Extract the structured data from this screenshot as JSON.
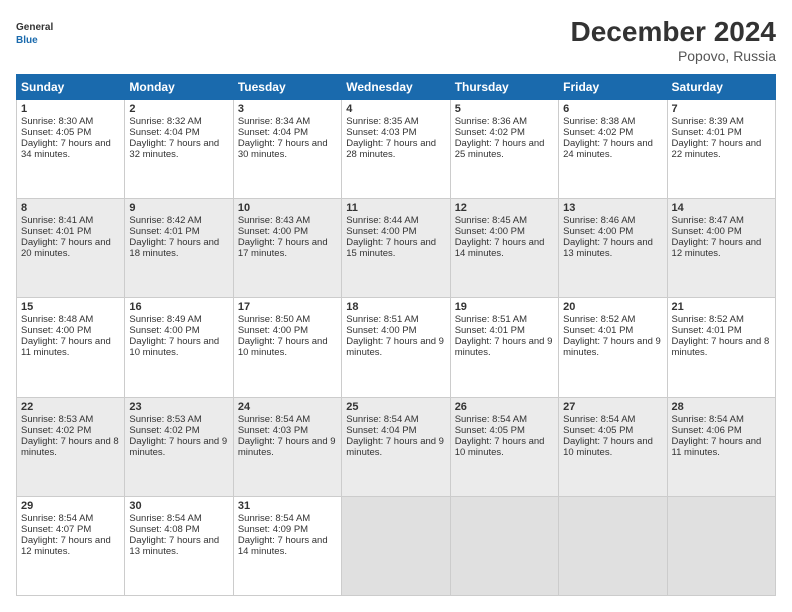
{
  "header": {
    "logo_line1": "General",
    "logo_line2": "Blue",
    "month": "December 2024",
    "location": "Popovo, Russia"
  },
  "weekdays": [
    "Sunday",
    "Monday",
    "Tuesday",
    "Wednesday",
    "Thursday",
    "Friday",
    "Saturday"
  ],
  "weeks": [
    [
      {
        "day": "1",
        "sunrise": "Sunrise: 8:30 AM",
        "sunset": "Sunset: 4:05 PM",
        "daylight": "Daylight: 7 hours and 34 minutes."
      },
      {
        "day": "2",
        "sunrise": "Sunrise: 8:32 AM",
        "sunset": "Sunset: 4:04 PM",
        "daylight": "Daylight: 7 hours and 32 minutes."
      },
      {
        "day": "3",
        "sunrise": "Sunrise: 8:34 AM",
        "sunset": "Sunset: 4:04 PM",
        "daylight": "Daylight: 7 hours and 30 minutes."
      },
      {
        "day": "4",
        "sunrise": "Sunrise: 8:35 AM",
        "sunset": "Sunset: 4:03 PM",
        "daylight": "Daylight: 7 hours and 28 minutes."
      },
      {
        "day": "5",
        "sunrise": "Sunrise: 8:36 AM",
        "sunset": "Sunset: 4:02 PM",
        "daylight": "Daylight: 7 hours and 25 minutes."
      },
      {
        "day": "6",
        "sunrise": "Sunrise: 8:38 AM",
        "sunset": "Sunset: 4:02 PM",
        "daylight": "Daylight: 7 hours and 24 minutes."
      },
      {
        "day": "7",
        "sunrise": "Sunrise: 8:39 AM",
        "sunset": "Sunset: 4:01 PM",
        "daylight": "Daylight: 7 hours and 22 minutes."
      }
    ],
    [
      {
        "day": "8",
        "sunrise": "Sunrise: 8:41 AM",
        "sunset": "Sunset: 4:01 PM",
        "daylight": "Daylight: 7 hours and 20 minutes."
      },
      {
        "day": "9",
        "sunrise": "Sunrise: 8:42 AM",
        "sunset": "Sunset: 4:01 PM",
        "daylight": "Daylight: 7 hours and 18 minutes."
      },
      {
        "day": "10",
        "sunrise": "Sunrise: 8:43 AM",
        "sunset": "Sunset: 4:00 PM",
        "daylight": "Daylight: 7 hours and 17 minutes."
      },
      {
        "day": "11",
        "sunrise": "Sunrise: 8:44 AM",
        "sunset": "Sunset: 4:00 PM",
        "daylight": "Daylight: 7 hours and 15 minutes."
      },
      {
        "day": "12",
        "sunrise": "Sunrise: 8:45 AM",
        "sunset": "Sunset: 4:00 PM",
        "daylight": "Daylight: 7 hours and 14 minutes."
      },
      {
        "day": "13",
        "sunrise": "Sunrise: 8:46 AM",
        "sunset": "Sunset: 4:00 PM",
        "daylight": "Daylight: 7 hours and 13 minutes."
      },
      {
        "day": "14",
        "sunrise": "Sunrise: 8:47 AM",
        "sunset": "Sunset: 4:00 PM",
        "daylight": "Daylight: 7 hours and 12 minutes."
      }
    ],
    [
      {
        "day": "15",
        "sunrise": "Sunrise: 8:48 AM",
        "sunset": "Sunset: 4:00 PM",
        "daylight": "Daylight: 7 hours and 11 minutes."
      },
      {
        "day": "16",
        "sunrise": "Sunrise: 8:49 AM",
        "sunset": "Sunset: 4:00 PM",
        "daylight": "Daylight: 7 hours and 10 minutes."
      },
      {
        "day": "17",
        "sunrise": "Sunrise: 8:50 AM",
        "sunset": "Sunset: 4:00 PM",
        "daylight": "Daylight: 7 hours and 10 minutes."
      },
      {
        "day": "18",
        "sunrise": "Sunrise: 8:51 AM",
        "sunset": "Sunset: 4:00 PM",
        "daylight": "Daylight: 7 hours and 9 minutes."
      },
      {
        "day": "19",
        "sunrise": "Sunrise: 8:51 AM",
        "sunset": "Sunset: 4:01 PM",
        "daylight": "Daylight: 7 hours and 9 minutes."
      },
      {
        "day": "20",
        "sunrise": "Sunrise: 8:52 AM",
        "sunset": "Sunset: 4:01 PM",
        "daylight": "Daylight: 7 hours and 9 minutes."
      },
      {
        "day": "21",
        "sunrise": "Sunrise: 8:52 AM",
        "sunset": "Sunset: 4:01 PM",
        "daylight": "Daylight: 7 hours and 8 minutes."
      }
    ],
    [
      {
        "day": "22",
        "sunrise": "Sunrise: 8:53 AM",
        "sunset": "Sunset: 4:02 PM",
        "daylight": "Daylight: 7 hours and 8 minutes."
      },
      {
        "day": "23",
        "sunrise": "Sunrise: 8:53 AM",
        "sunset": "Sunset: 4:02 PM",
        "daylight": "Daylight: 7 hours and 9 minutes."
      },
      {
        "day": "24",
        "sunrise": "Sunrise: 8:54 AM",
        "sunset": "Sunset: 4:03 PM",
        "daylight": "Daylight: 7 hours and 9 minutes."
      },
      {
        "day": "25",
        "sunrise": "Sunrise: 8:54 AM",
        "sunset": "Sunset: 4:04 PM",
        "daylight": "Daylight: 7 hours and 9 minutes."
      },
      {
        "day": "26",
        "sunrise": "Sunrise: 8:54 AM",
        "sunset": "Sunset: 4:05 PM",
        "daylight": "Daylight: 7 hours and 10 minutes."
      },
      {
        "day": "27",
        "sunrise": "Sunrise: 8:54 AM",
        "sunset": "Sunset: 4:05 PM",
        "daylight": "Daylight: 7 hours and 10 minutes."
      },
      {
        "day": "28",
        "sunrise": "Sunrise: 8:54 AM",
        "sunset": "Sunset: 4:06 PM",
        "daylight": "Daylight: 7 hours and 11 minutes."
      }
    ],
    [
      {
        "day": "29",
        "sunrise": "Sunrise: 8:54 AM",
        "sunset": "Sunset: 4:07 PM",
        "daylight": "Daylight: 7 hours and 12 minutes."
      },
      {
        "day": "30",
        "sunrise": "Sunrise: 8:54 AM",
        "sunset": "Sunset: 4:08 PM",
        "daylight": "Daylight: 7 hours and 13 minutes."
      },
      {
        "day": "31",
        "sunrise": "Sunrise: 8:54 AM",
        "sunset": "Sunset: 4:09 PM",
        "daylight": "Daylight: 7 hours and 14 minutes."
      },
      null,
      null,
      null,
      null
    ]
  ]
}
